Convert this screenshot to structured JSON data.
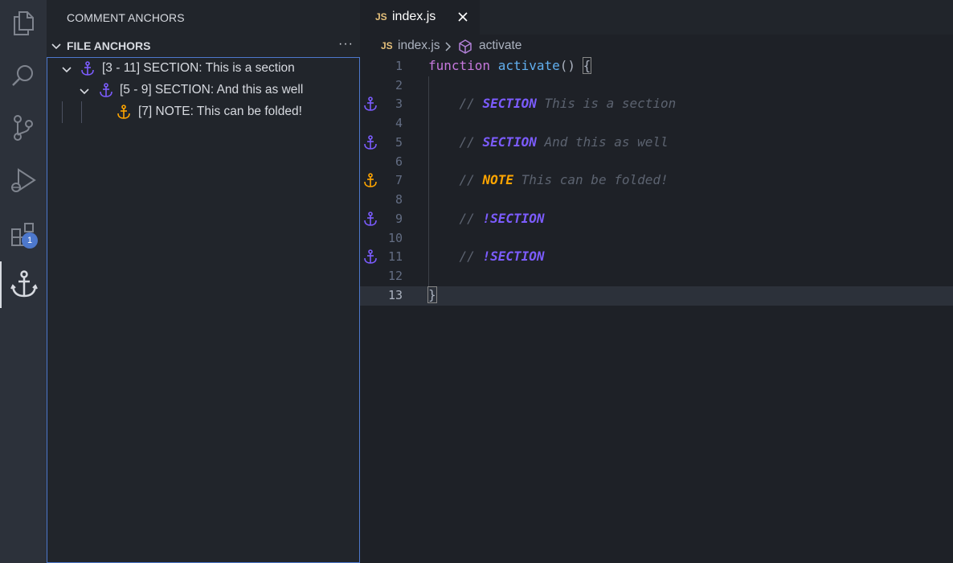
{
  "activity_bar": {
    "items": [
      "files-icon",
      "search-icon",
      "source-control-icon",
      "run-debug-icon",
      "extensions-icon",
      "anchor-icon"
    ],
    "extensions_badge": "1"
  },
  "sidebar": {
    "title": "COMMENT ANCHORS",
    "section_title": "FILE ANCHORS",
    "more_label": "···",
    "tree": [
      {
        "label": "[3 - 11] SECTION: This is a section",
        "color": "#7c5cff"
      },
      {
        "label": "[5 - 9] SECTION: And this as well",
        "color": "#7c5cff"
      },
      {
        "label": "[7] NOTE: This can be folded!",
        "color": "#ffa500"
      }
    ]
  },
  "editor": {
    "tab": {
      "icon": "JS",
      "name": "index.js"
    },
    "breadcrumb": {
      "icon": "JS",
      "file": "index.js",
      "symbol": "activate"
    },
    "line_numbers": [
      "1",
      "2",
      "3",
      "4",
      "5",
      "6",
      "7",
      "8",
      "9",
      "10",
      "11",
      "12",
      "13"
    ],
    "code": {
      "l1_kw": "function",
      "l1_fn": "activate",
      "l1_paren": "()",
      "l1_brace": "{",
      "comment_prefix": "//",
      "l3_tag": "SECTION",
      "l3_text": "This is a section",
      "l5_tag": "SECTION",
      "l5_text": "And this as well",
      "l7_tag": "NOTE",
      "l7_text": "This can be folded!",
      "l9_tag": "!SECTION",
      "l11_tag": "!SECTION",
      "l13_brace": "}"
    }
  },
  "colors": {
    "section": "#7c5cff",
    "note": "#ffa500",
    "focus_border": "#4d78cc"
  }
}
